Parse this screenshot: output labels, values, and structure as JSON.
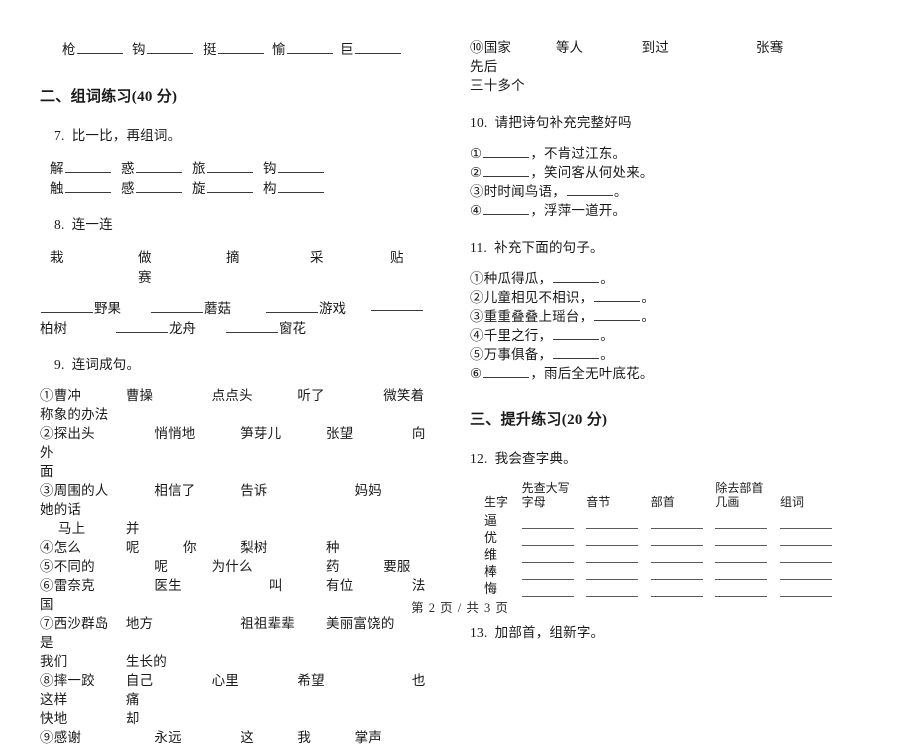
{
  "document": {
    "page_footer": "第 2 页 / 共 3 页"
  },
  "left_column": {
    "top_char_blanks": {
      "chars": [
        "枪",
        "钩",
        "挺",
        "愉",
        "巨"
      ]
    },
    "section2": {
      "heading": "二、组词练习(40 分)"
    },
    "q7": {
      "number": "7.",
      "title": "比一比，再组词。",
      "row1": [
        "解",
        "惑",
        "旅",
        "钩"
      ],
      "row2": [
        "触",
        "感",
        "旋",
        "构"
      ]
    },
    "q8": {
      "number": "8.",
      "title": "连一连",
      "verbs": [
        "栽",
        "做",
        "摘",
        "采",
        "贴"
      ],
      "verbs_wrap": "赛",
      "nouns_line1": [
        "野果",
        "蘑菇",
        "游戏"
      ],
      "nouns_line2": [
        "柏树",
        "龙舟",
        "窗花"
      ]
    },
    "q9": {
      "number": "9.",
      "title": "连词成句。",
      "items": [
        {
          "marker": "①",
          "line1": "曹冲\t\t曹操\t\t点点头\t\t听了\t\t微笑着",
          "line2": "称象的办法"
        },
        {
          "marker": "②",
          "line1": "探出头\t\t\t悄悄地\t\t笋芽儿\t\t张望\t\t向外",
          "line2": "面"
        },
        {
          "marker": "③",
          "line1": "周围的人\t\t相信了\t\t告诉\t\t\t妈妈\t\t她的话",
          "line2": "     马上\t\t并"
        },
        {
          "marker": "④",
          "line1": "怎么\t\t呢\t\t你\t\t梨树\t\t种",
          "line2": ""
        },
        {
          "marker": "⑤",
          "line1": "不同的\t\t\t呢\t\t为什么\t\t\t药\t\t要服",
          "line2": ""
        },
        {
          "marker": "⑥",
          "line1": "雷奈克\t\t\t医生\t\t\t叫\t\t有位\t\t法国",
          "line2": ""
        },
        {
          "marker": "⑦",
          "line1": "西沙群岛\t地方\t\t\t祖祖辈辈\t\t美丽富饶的\t\t\t是",
          "line2": "我们\t\t生长的"
        },
        {
          "marker": "⑧",
          "line1": "摔一跤\t\t自己\t\t心里\t\t希望\t\t\t也这样\t\t痛",
          "line2": "快地\t\t却"
        },
        {
          "marker": "⑨",
          "line1": "感谢\t\t\t永远\t\t这\t\t我\t\t掌声",
          "line2": ""
        }
      ]
    }
  },
  "right_column": {
    "q9_continued": {
      "marker": "⑩",
      "line1": "国家\t\t等人\t\t到过\t\t\t张骞\t\t\t先后",
      "line2": "三十多个"
    },
    "q10": {
      "number": "10.",
      "title": "请把诗句补充完整好吗",
      "items": [
        {
          "marker": "①",
          "before": "",
          "after": "，不肯过江东。"
        },
        {
          "marker": "②",
          "before": "",
          "after": "，笑问客从何处来。"
        },
        {
          "marker": "③",
          "before": "时时闻鸟语，",
          "after": "。"
        },
        {
          "marker": "④",
          "before": "",
          "after": "，浮萍一道开。"
        }
      ]
    },
    "q11": {
      "number": "11.",
      "title": "补充下面的句子。",
      "items": [
        {
          "marker": "①",
          "before": "种瓜得瓜，",
          "after": "。"
        },
        {
          "marker": "②",
          "before": "儿童相见不相识，",
          "after": "。"
        },
        {
          "marker": "③",
          "before": "重重叠叠上瑶台，",
          "after": "。"
        },
        {
          "marker": "④",
          "before": "千里之行，",
          "after": "。"
        },
        {
          "marker": "⑤",
          "before": "万事俱备，",
          "after": "。"
        },
        {
          "marker": "⑥",
          "before": "",
          "after": "，雨后全无叶底花。"
        }
      ]
    },
    "section3": {
      "heading": "三、提升练习(20 分)"
    },
    "q12": {
      "number": "12.",
      "title": "我会查字典。",
      "table": {
        "headers": [
          "生字",
          "先查大写字母",
          "音节",
          "部首",
          "除去部首几画",
          "组词"
        ],
        "rows": [
          "逼",
          "优",
          "维",
          "棒",
          "悔"
        ]
      }
    },
    "q13": {
      "number": "13.",
      "title": "加部首，组新字。"
    }
  }
}
